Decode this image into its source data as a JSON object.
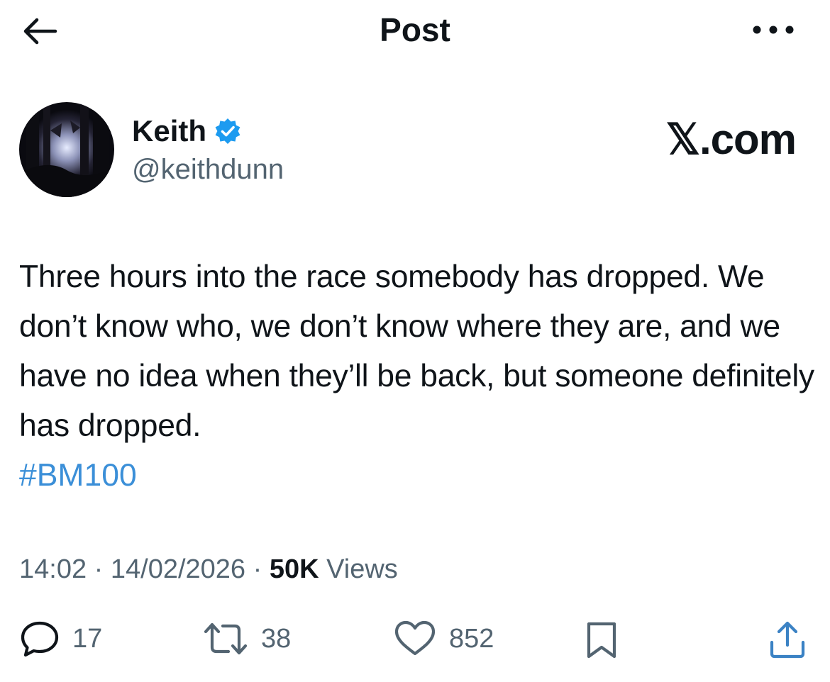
{
  "header": {
    "title": "Post",
    "back_icon": "arrow-left-icon",
    "more_icon": "more-horizontal-icon"
  },
  "author": {
    "name": "Keith",
    "handle": "@keithdunn",
    "verified": true,
    "verified_color": "#1d9bf0"
  },
  "brand": "𝕏.com",
  "post": {
    "text": "Three hours into the race somebody has dropped. We don’t know who, we don’t know where they are, and we have no idea when they’ll be back, but someone definitely has dropped.",
    "hashtag": "#BM100",
    "hashtag_color": "#3b8fd8"
  },
  "meta": {
    "time": "14:02",
    "sep1": " · ",
    "date": "14/02/2026",
    "sep2": " · ",
    "views_count": "50K",
    "views_label": " Views"
  },
  "actions": {
    "replies": "17",
    "reposts": "38",
    "likes": "852"
  }
}
